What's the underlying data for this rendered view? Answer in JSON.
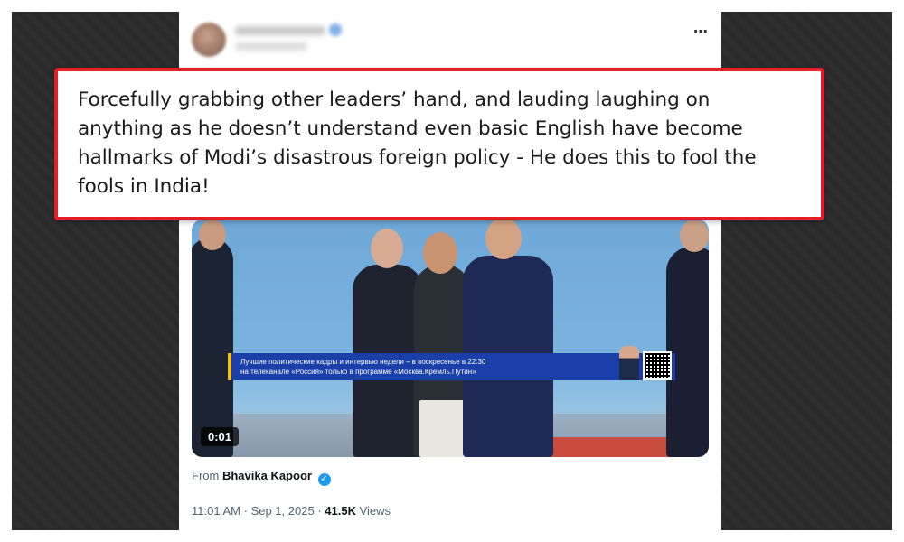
{
  "tweet": {
    "more_icon": "⋯",
    "video": {
      "ticker_line1": "Лучшие политические кадры и интервью недели – в воскресенье в 22:30",
      "ticker_line2": "на телеканале «Россия» только в программе «Москва.Кремль.Путин»",
      "timestamp": "0:01"
    },
    "from_label": "From",
    "author": "Bhavika Kapoor",
    "verified_icon": "✓",
    "time": "11:01 AM",
    "separator": "·",
    "date": "Sep 1, 2025",
    "views_count": "41.5K",
    "views_label": "Views"
  },
  "callout": {
    "text": "Forcefully grabbing other leaders’ hand, and lauding laughing on anything as he doesn’t understand even basic English have become hallmarks of Modi’s disastrous foreign policy - He does this to fool the fools in India!",
    "border_color": "#e31e24"
  },
  "colors": {
    "background": "#2b2b2b",
    "link_blue": "#1d9bf0",
    "ticker_blue": "#1a3fa8"
  }
}
